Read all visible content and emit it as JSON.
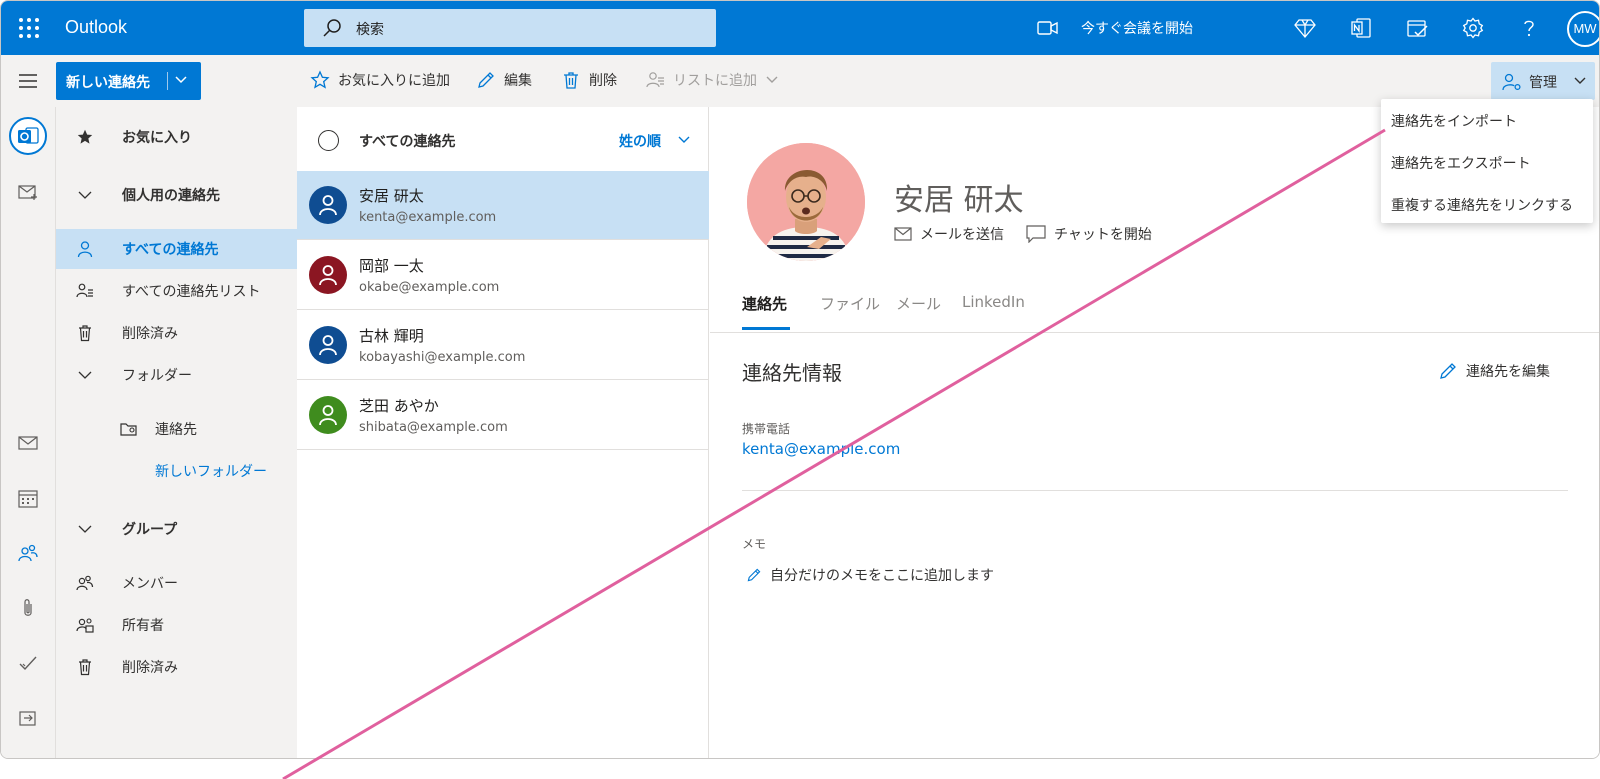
{
  "app": {
    "title": "Outlook",
    "user_initials": "MW"
  },
  "search": {
    "placeholder": "検索"
  },
  "topbar": {
    "meet_now": "今すぐ会議を開始"
  },
  "command_bar": {
    "new_contact": "新しい連絡先",
    "add_favorite": "お気に入りに追加",
    "edit": "編集",
    "delete": "削除",
    "add_to_list": "リストに追加",
    "manage": "管理"
  },
  "folders": {
    "favorites": "お気に入り",
    "personal_contacts": "個人用の連絡先",
    "all_contacts": "すべての連絡先",
    "all_contact_lists": "すべての連絡先リスト",
    "deleted": "削除済み",
    "folders": "フォルダー",
    "contacts_folder": "連絡先",
    "new_folder": "新しいフォルダー",
    "groups": "グループ",
    "member": "メンバー",
    "owner": "所有者",
    "groups_deleted": "削除済み"
  },
  "list": {
    "title": "すべての連絡先",
    "sort": "姓の順",
    "contacts": [
      {
        "name": "安居 研太",
        "email": "kenta@example.com",
        "color": "#0f4d92"
      },
      {
        "name": "岡部 一太",
        "email": "okabe@example.com",
        "color": "#8b1622"
      },
      {
        "name": "古林 輝明",
        "email": "kobayashi@example.com",
        "color": "#0f4d92"
      },
      {
        "name": "芝田 あやか",
        "email": "shibata@example.com",
        "color": "#3f8c1e"
      }
    ]
  },
  "detail": {
    "name": "安居 研太",
    "send_mail": "メールを送信",
    "start_chat": "チャットを開始",
    "tabs": [
      "連絡先",
      "ファイル",
      "メール",
      "LinkedIn"
    ],
    "section_title": "連絡先情報",
    "edit_contact": "連絡先を編集",
    "phone_label": "携帯電話",
    "phone_value": "kenta@example.com",
    "memo_label": "メモ",
    "memo_add": "自分だけのメモをここに追加します"
  },
  "manage_menu": {
    "items": [
      "連絡先をインポート",
      "連絡先をエクスポート",
      "重複する連絡先をリンクする"
    ]
  },
  "colors": {
    "brand": "#0078d4",
    "selection": "#c7e0f4",
    "annotation": "#e0609e"
  }
}
